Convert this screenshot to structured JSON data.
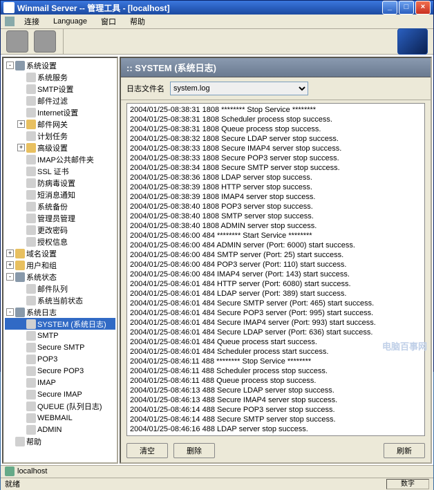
{
  "titlebar": {
    "title": "Winmail Server -- 管理工具 - [localhost]"
  },
  "menubar": {
    "items": [
      "连接",
      "Language",
      "窗口",
      "帮助"
    ]
  },
  "tree": [
    {
      "d": 0,
      "e": "-",
      "i": "gear",
      "t": "系统设置"
    },
    {
      "d": 1,
      "e": "",
      "i": "page",
      "t": "系统服务"
    },
    {
      "d": 1,
      "e": "",
      "i": "page",
      "t": "SMTP设置"
    },
    {
      "d": 1,
      "e": "",
      "i": "page",
      "t": "邮件过滤"
    },
    {
      "d": 1,
      "e": "",
      "i": "page",
      "t": "Internet设置"
    },
    {
      "d": 1,
      "e": "+",
      "i": "folder",
      "t": "邮件网关"
    },
    {
      "d": 1,
      "e": "",
      "i": "page",
      "t": "计划任务"
    },
    {
      "d": 1,
      "e": "+",
      "i": "folder",
      "t": "高级设置"
    },
    {
      "d": 1,
      "e": "",
      "i": "page",
      "t": "IMAP公共邮件夹"
    },
    {
      "d": 1,
      "e": "",
      "i": "page",
      "t": "SSL 证书"
    },
    {
      "d": 1,
      "e": "",
      "i": "page",
      "t": "防病毒设置"
    },
    {
      "d": 1,
      "e": "",
      "i": "page",
      "t": "短消息通知"
    },
    {
      "d": 1,
      "e": "",
      "i": "page",
      "t": "系统备份"
    },
    {
      "d": 1,
      "e": "",
      "i": "page",
      "t": "管理员管理"
    },
    {
      "d": 1,
      "e": "",
      "i": "page",
      "t": "更改密码"
    },
    {
      "d": 1,
      "e": "",
      "i": "page",
      "t": "授权信息"
    },
    {
      "d": 0,
      "e": "+",
      "i": "folder",
      "t": "域名设置"
    },
    {
      "d": 0,
      "e": "+",
      "i": "folder",
      "t": "用户和组"
    },
    {
      "d": 0,
      "e": "-",
      "i": "gear",
      "t": "系统状态"
    },
    {
      "d": 1,
      "e": "",
      "i": "page",
      "t": "邮件队列"
    },
    {
      "d": 1,
      "e": "",
      "i": "page",
      "t": "系统当前状态"
    },
    {
      "d": 0,
      "e": "-",
      "i": "gear",
      "t": "系统日志"
    },
    {
      "d": 1,
      "e": "",
      "i": "page",
      "t": "SYSTEM (系统日志)",
      "sel": true
    },
    {
      "d": 1,
      "e": "",
      "i": "page",
      "t": "SMTP"
    },
    {
      "d": 1,
      "e": "",
      "i": "page",
      "t": "Secure SMTP"
    },
    {
      "d": 1,
      "e": "",
      "i": "page",
      "t": "POP3"
    },
    {
      "d": 1,
      "e": "",
      "i": "page",
      "t": "Secure POP3"
    },
    {
      "d": 1,
      "e": "",
      "i": "page",
      "t": "IMAP"
    },
    {
      "d": 1,
      "e": "",
      "i": "page",
      "t": "Secure IMAP"
    },
    {
      "d": 1,
      "e": "",
      "i": "page",
      "t": "QUEUE (队列日志)"
    },
    {
      "d": 1,
      "e": "",
      "i": "page",
      "t": "WEBMAIL"
    },
    {
      "d": 1,
      "e": "",
      "i": "page",
      "t": "ADMIN"
    },
    {
      "d": 0,
      "e": "",
      "i": "page",
      "t": "帮助"
    }
  ],
  "content": {
    "header": ":: SYSTEM (系统日志)",
    "filter_label": "日志文件名",
    "filter_value": "system.log",
    "buttons": {
      "clear": "清空",
      "delete": "删除",
      "refresh": "刷新"
    }
  },
  "log": [
    "2004/01/25-08:38:31   1808 ******** Stop Service ********",
    "2004/01/25-08:38:31   1808 Scheduler process stop success.",
    "2004/01/25-08:38:31   1808 Queue process stop success.",
    "2004/01/25-08:38:32   1808 Secure LDAP server stop success.",
    "2004/01/25-08:38:33   1808 Secure IMAP4 server stop success.",
    "2004/01/25-08:38:33   1808 Secure POP3 server stop success.",
    "2004/01/25-08:38:34   1808 Secure SMTP server stop success.",
    "2004/01/25-08:38:36   1808 LDAP server stop success.",
    "2004/01/25-08:38:39   1808 HTTP server stop success.",
    "2004/01/25-08:38:39   1808 IMAP4 server stop success.",
    "2004/01/25-08:38:40   1808 POP3 server stop success.",
    "2004/01/25-08:38:40   1808 SMTP server stop success.",
    "2004/01/25-08:38:40   1808 ADMIN server stop success.",
    "2004/01/25-08:46:00    484 ******** Start Service ********",
    "2004/01/25-08:46:00    484 ADMIN server (Port: 6000) start success.",
    "2004/01/25-08:46:00    484 SMTP server (Port: 25) start success.",
    "2004/01/25-08:46:00    484 POP3 server (Port: 110) start success.",
    "2004/01/25-08:46:00    484 IMAP4 server (Port: 143) start success.",
    "2004/01/25-08:46:01    484 HTTP server (Port: 6080) start success.",
    "2004/01/25-08:46:01    484 LDAP server (Port: 389) start success.",
    "2004/01/25-08:46:01    484 Secure SMTP server (Port: 465) start success.",
    "2004/01/25-08:46:01    484 Secure POP3 server (Port: 995) start success.",
    "2004/01/25-08:46:01    484 Secure IMAP4 server (Port: 993) start success.",
    "2004/01/25-08:46:01    484 Secure LDAP server (Port: 636) start success.",
    "2004/01/25-08:46:01    484 Queue process start success.",
    "2004/01/25-08:46:01    484 Scheduler process start success.",
    "2004/01/25-08:46:11    488 ******** Stop Service ********",
    "2004/01/25-08:46:11    488 Scheduler process stop success.",
    "2004/01/25-08:46:11    488 Queue process stop success.",
    "2004/01/25-08:46:13    488 Secure LDAP server stop success.",
    "2004/01/25-08:46:13    488 Secure IMAP4 server stop success.",
    "2004/01/25-08:46:14    488 Secure POP3 server stop success.",
    "2004/01/25-08:46:14    488 Secure SMTP server stop success.",
    "2004/01/25-08:46:16    488 LDAP server stop success."
  ],
  "status": {
    "host": "localhost",
    "ready": "就绪",
    "num_label": "数字"
  },
  "watermark": "电脑百事网"
}
